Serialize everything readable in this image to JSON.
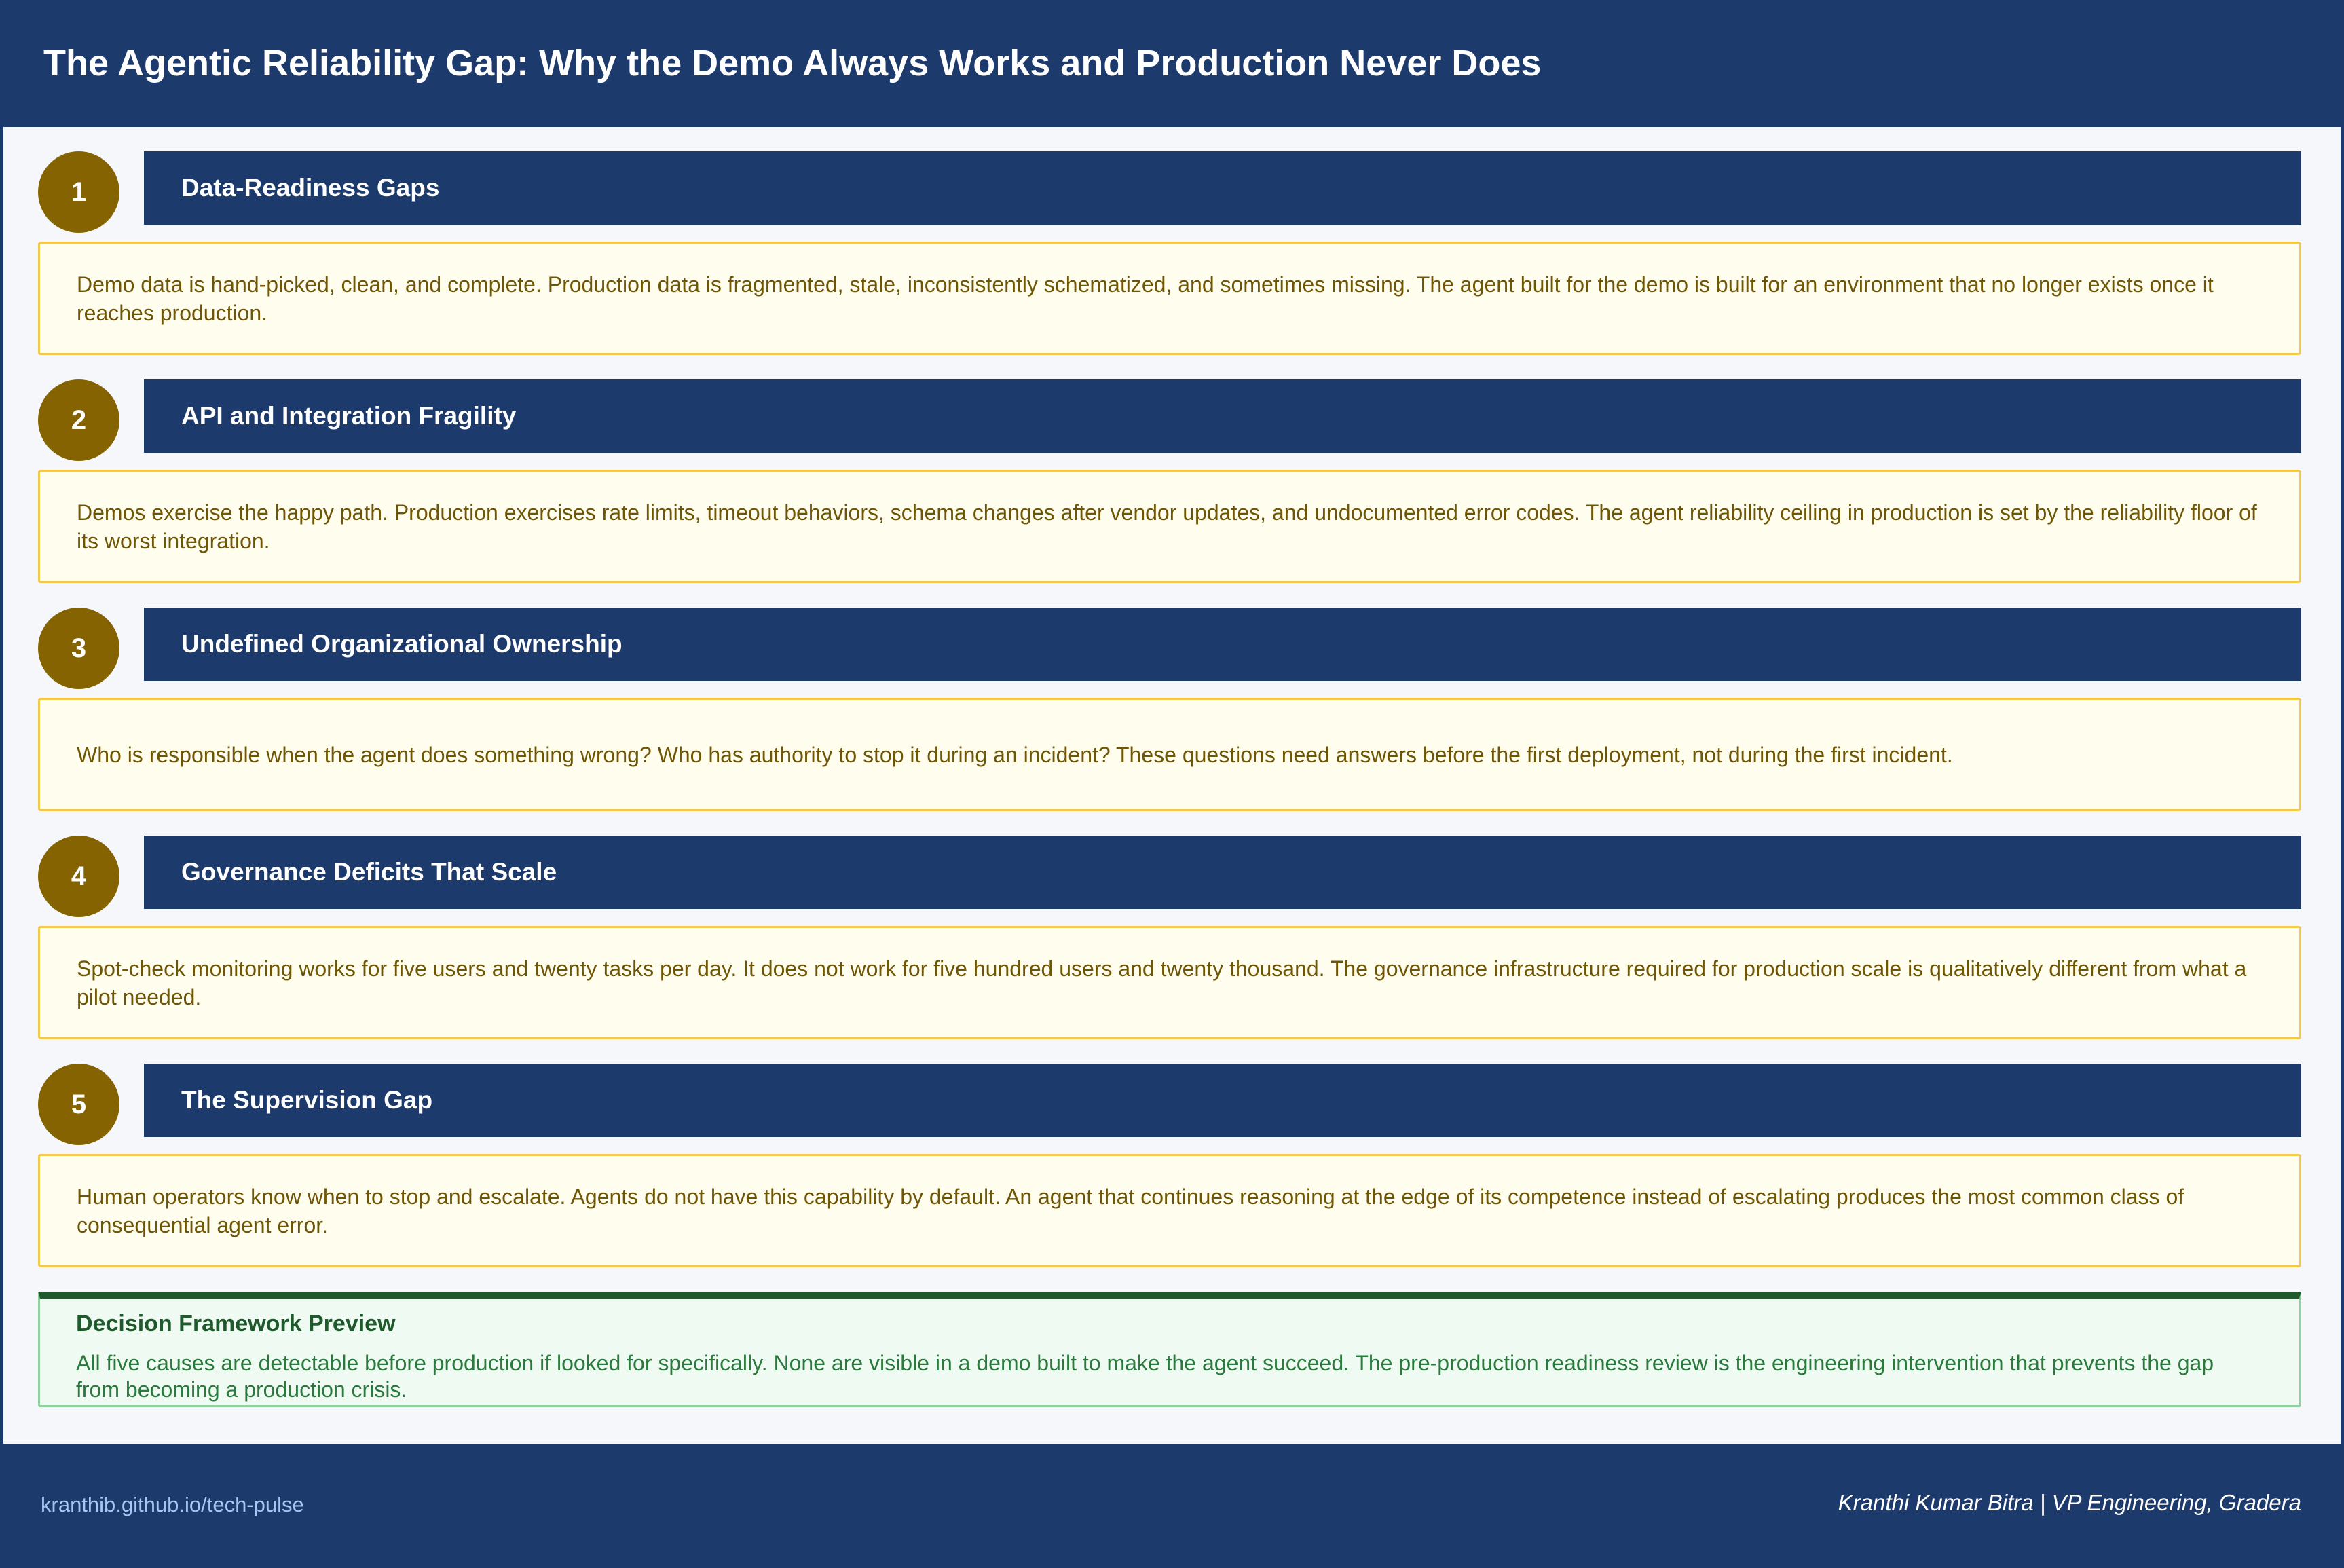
{
  "header": {
    "title": "The Agentic Reliability Gap: Why the Demo Always Works and Production Never Does"
  },
  "sections": [
    {
      "number": "1",
      "title": "Data-Readiness Gaps",
      "text": "Demo data is hand-picked, clean, and complete. Production data is fragmented, stale, inconsistently schematized, and sometimes missing. The agent built for the demo is built for an environment that no longer exists once it reaches production."
    },
    {
      "number": "2",
      "title": "API and Integration Fragility",
      "text": "Demos exercise the happy path. Production exercises rate limits, timeout behaviors, schema changes after vendor updates, and undocumented error codes. The agent reliability ceiling in production is set by the reliability floor of its worst integration."
    },
    {
      "number": "3",
      "title": "Undefined Organizational Ownership",
      "text": "Who is responsible when the agent does something wrong? Who has authority to stop it during an incident? These questions need answers before the first deployment, not during the first incident."
    },
    {
      "number": "4",
      "title": "Governance Deficits That Scale",
      "text": "Spot-check monitoring works for five users and twenty tasks per day. It does not work for five hundred users and twenty thousand. The governance infrastructure required for production scale is qualitatively different from what a pilot needed."
    },
    {
      "number": "5",
      "title": "The Supervision Gap",
      "text": "Human operators know when to stop and escalate. Agents do not have this capability by default. An agent that continues reasoning at the edge of its competence instead of escalating produces the most common class of consequential agent error."
    }
  ],
  "preview": {
    "title": "Decision Framework Preview",
    "text": "All five causes are detectable before production if looked for specifically. None are visible in a demo built to make the agent succeed. The pre-production readiness review is the engineering intervention that prevents the gap from becoming a production crisis."
  },
  "footer": {
    "link": "kranthib.github.io/tech-pulse",
    "author": "Kranthi Kumar Bitra | VP Engineering, Gradera"
  },
  "colors": {
    "navy": "#1d3a6d",
    "gold": "#846300",
    "card_border": "#f2c94a",
    "card_bg": "#fffdee",
    "green_dark": "#1f5a2c",
    "green_bg": "#effaf2"
  }
}
